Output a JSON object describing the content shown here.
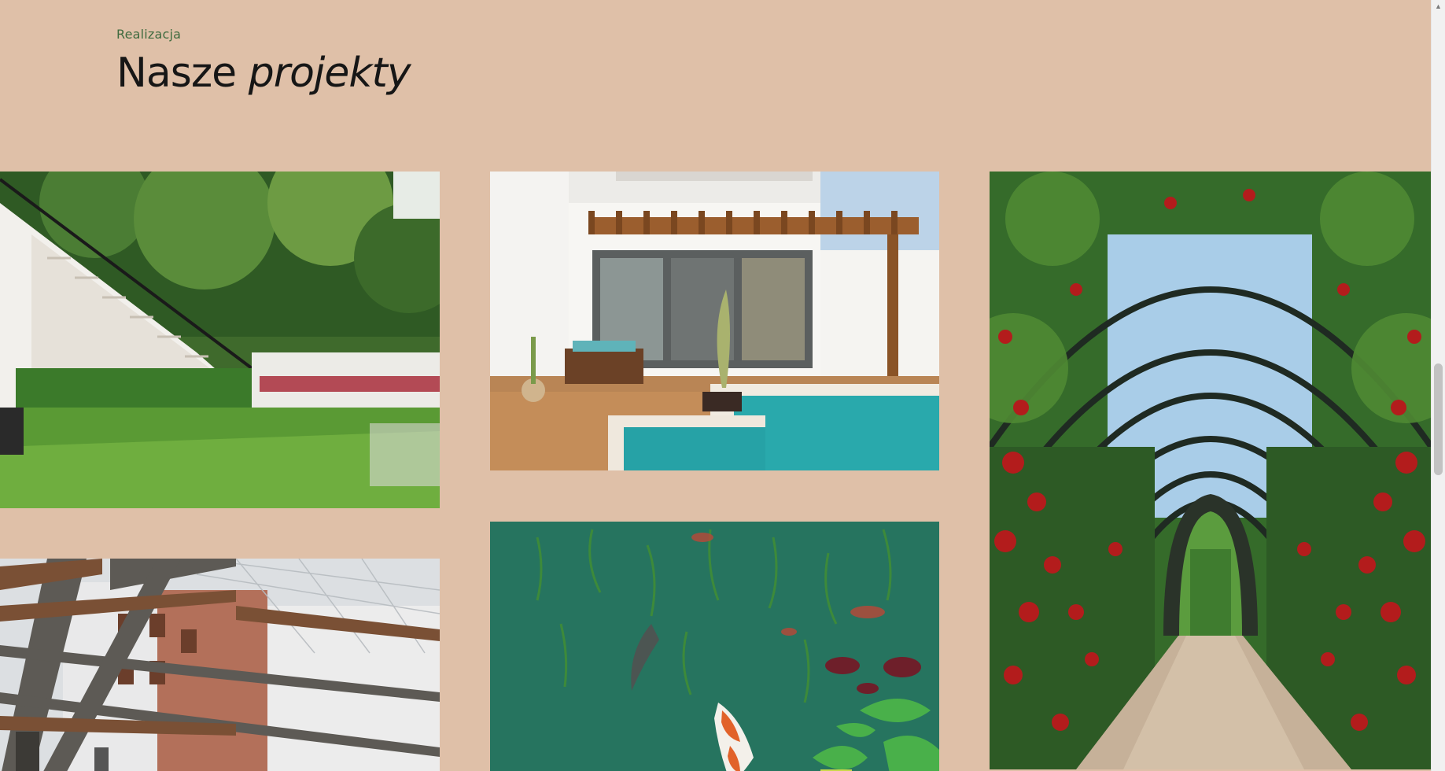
{
  "section": {
    "eyebrow": "Realizacja",
    "title_plain": "Nasze",
    "title_emphasis": "projekty"
  },
  "projects": [
    {
      "image": "garden-stairs-lawn"
    },
    {
      "image": "pool-pergola-patio"
    },
    {
      "image": "rose-arch-tunnel"
    },
    {
      "image": "wooden-pergola-roof"
    },
    {
      "image": "koi-pond"
    }
  ],
  "colors": {
    "background": "#dfc0a8",
    "eyebrow": "#3f6b3f",
    "title": "#161616"
  },
  "scrollbar": {
    "up_arrow": "▲"
  }
}
